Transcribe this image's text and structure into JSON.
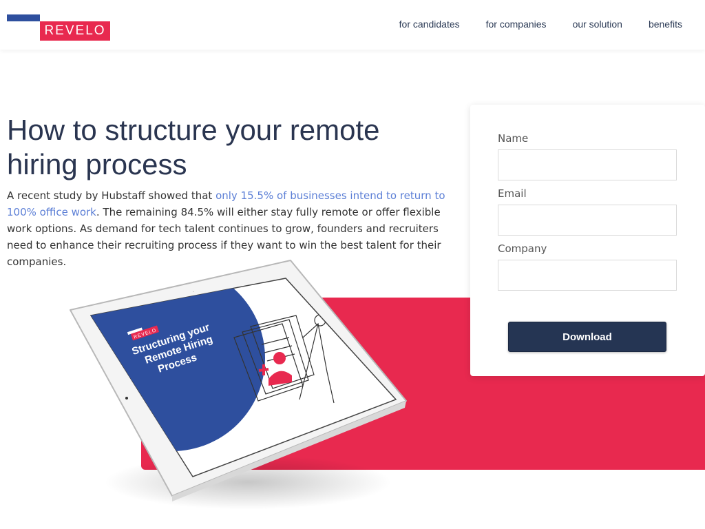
{
  "brand": {
    "name": "REVELO",
    "red": "#e8294f",
    "blue": "#2e4f9e",
    "navy": "#253553"
  },
  "nav": {
    "items": [
      {
        "label": "for candidates"
      },
      {
        "label": "for companies"
      },
      {
        "label": "our solution"
      },
      {
        "label": "benefits"
      }
    ]
  },
  "hero": {
    "title": "How to structure your remote hiring process",
    "intro_before": "A recent study by Hubstaff showed that ",
    "intro_link": "only 15.5% of businesses intend to return to 100% office work",
    "intro_after": ". The remaining 84.5% will either stay fully remote or offer flexible work options. As demand for tech talent continues to grow, founders and recruiters need to enhance their recruiting process if they want to win the best talent for their companies."
  },
  "tablet": {
    "logo": "REVELO",
    "cover_line1": "Structuring your",
    "cover_line2": "Remote Hiring",
    "cover_line3": "Process"
  },
  "form": {
    "name_label": "Name",
    "name_value": "",
    "email_label": "Email",
    "email_value": "",
    "company_label": "Company",
    "company_value": "",
    "submit_label": "Download"
  }
}
